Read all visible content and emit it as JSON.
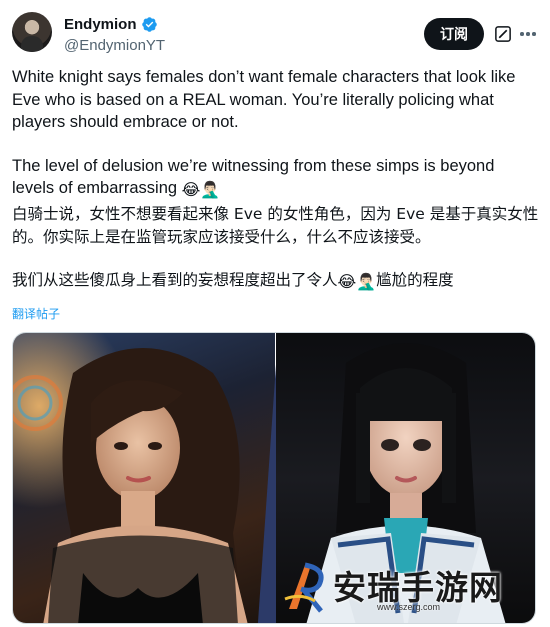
{
  "author": {
    "display_name": "Endymion",
    "handle": "@EndymionYT",
    "verified": true
  },
  "actions": {
    "subscribe_label": "订阅"
  },
  "tweet": {
    "en_p1": "White knight says females don’t want female characters that look like Eve who is based on a REAL woman. You’re literally policing what players should embrace or not.",
    "en_p2": "The level of delusion we’re witnessing from these simps is beyond levels of embarrassing",
    "en_p2_emojis": "😂🤦🏻‍♂️",
    "zh_p1": "白骑士说，女性不想要看起来像 Eve 的女性角色，因为 Eve 是基于真实女性的。你实际上是在监管玩家应该接受什么，什么不应该接受。",
    "zh_p2_before": "我们从这些傻瓜身上看到的妄想程度超出了令人",
    "zh_p2_emojis": "😂🤦🏻‍♂️",
    "zh_p2_after": "尴尬的程度"
  },
  "translate_label": "翻译帖子",
  "watermark": {
    "site_name": "安瑞手游网",
    "url": "www.szerg.com"
  },
  "colors": {
    "link": "#1d9bf0",
    "verified": "#1d9bf0",
    "text": "#0f1419",
    "secondary": "#536471"
  }
}
